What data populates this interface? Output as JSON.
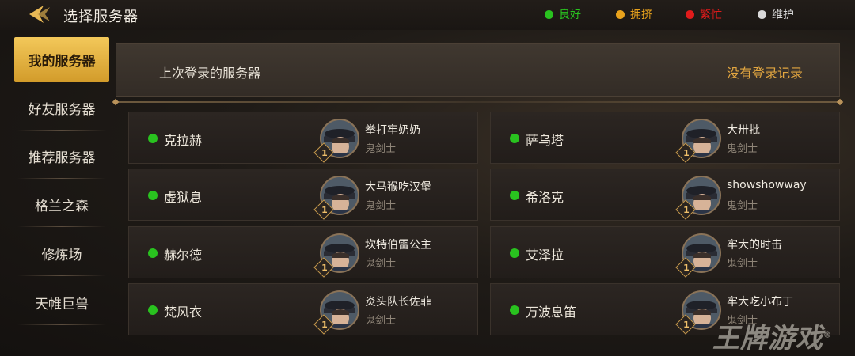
{
  "header": {
    "title": "选择服务器",
    "legend": [
      {
        "label": "良好",
        "color": "#29c21f"
      },
      {
        "label": "拥挤",
        "color": "#e8a21c"
      },
      {
        "label": "繁忙",
        "color": "#e01b1b"
      },
      {
        "label": "维护",
        "color": "#d9d9d9"
      }
    ]
  },
  "sidebar": {
    "tabs": [
      {
        "label": "我的服务器",
        "active": true
      },
      {
        "label": "好友服务器"
      },
      {
        "label": "推荐服务器"
      },
      {
        "label": "格兰之森"
      },
      {
        "label": "修炼场"
      },
      {
        "label": "天帷巨兽"
      }
    ]
  },
  "recent": {
    "label": "上次登录的服务器",
    "empty_text": "没有登录记录"
  },
  "servers": [
    {
      "name": "克拉赫",
      "status_color": "#29c21f",
      "character": "拳打牢奶奶",
      "class": "鬼剑士",
      "level": "1"
    },
    {
      "name": "萨乌塔",
      "status_color": "#29c21f",
      "character": "大卅批",
      "class": "鬼剑士",
      "level": "1"
    },
    {
      "name": "虚狱息",
      "status_color": "#29c21f",
      "character": "大马猴吃汉堡",
      "class": "鬼剑士",
      "level": "1"
    },
    {
      "name": "希洛克",
      "status_color": "#29c21f",
      "character": "showshowway",
      "class": "鬼剑士",
      "level": "1"
    },
    {
      "name": "赫尔德",
      "status_color": "#29c21f",
      "character": "坎特伯雷公主",
      "class": "鬼剑士",
      "level": "1"
    },
    {
      "name": "艾泽拉",
      "status_color": "#29c21f",
      "character": "牢大的时击",
      "class": "鬼剑士",
      "level": "1"
    },
    {
      "name": "梵风衣",
      "status_color": "#29c21f",
      "character": "炎头队长佐菲",
      "class": "鬼剑士",
      "level": "1"
    },
    {
      "name": "万波息笛",
      "status_color": "#29c21f",
      "character": "牢大吃小布丁",
      "class": "鬼剑士",
      "level": "1"
    }
  ],
  "watermark": {
    "text": "王牌游戏",
    "mark": "®"
  },
  "icons": {
    "back": "back-arrow-icon",
    "avatar": "character-avatar-icon"
  }
}
